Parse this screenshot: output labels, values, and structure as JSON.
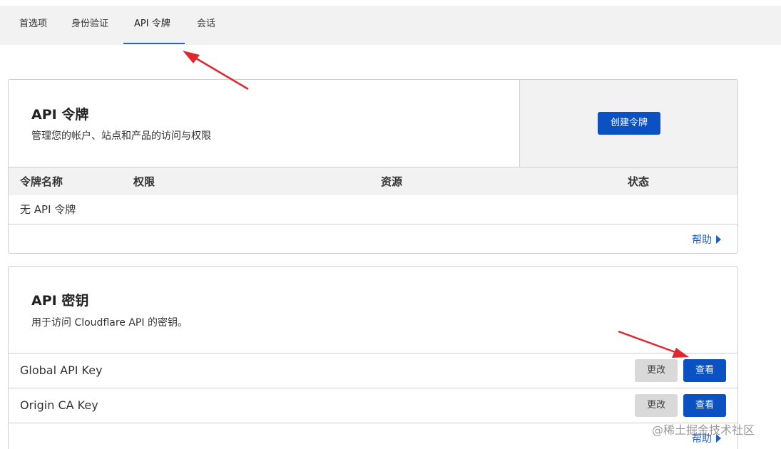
{
  "tabs": [
    {
      "label": "首选项"
    },
    {
      "label": "身份验证"
    },
    {
      "label": "API 令牌"
    },
    {
      "label": "会话"
    }
  ],
  "active_tab": "API 令牌",
  "api_tokens": {
    "title": "API 令牌",
    "description": "管理您的帐户、站点和产品的访问与权限",
    "create_button": "创建令牌",
    "columns": [
      "令牌名称",
      "权限",
      "资源",
      "状态"
    ],
    "empty_text": "无 API 令牌",
    "help_label": "帮助"
  },
  "api_keys": {
    "title": "API 密钥",
    "description": "用于访问 Cloudflare API 的密钥。",
    "keys": [
      {
        "name": "Global API Key",
        "change_label": "更改",
        "view_label": "查看"
      },
      {
        "name": "Origin CA Key",
        "change_label": "更改",
        "view_label": "查看"
      }
    ],
    "help_label": "帮助"
  },
  "watermark": "@稀土掘金技术社区",
  "colors": {
    "primary": "#0a51c4",
    "link": "#1f5fc2",
    "annotation_arrow": "#e0282e",
    "tab_bar": "#f2f2f2"
  }
}
